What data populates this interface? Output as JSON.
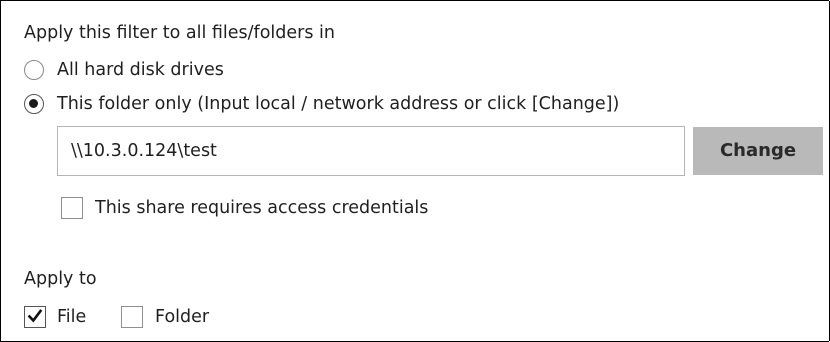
{
  "filter_scope": {
    "heading": "Apply this filter to all files/folders in",
    "options": [
      {
        "label": "All hard disk drives",
        "selected": false
      },
      {
        "label": "This folder only (Input local / network address or click [Change])",
        "selected": true
      }
    ],
    "path_input": {
      "value": "\\\\10.3.0.124\\test"
    },
    "change_button": {
      "label": "Change"
    },
    "credentials_checkbox": {
      "label": "This share requires access credentials",
      "checked": false
    }
  },
  "apply_to": {
    "heading": "Apply to",
    "options": [
      {
        "label": "File",
        "checked": true
      },
      {
        "label": "Folder",
        "checked": false
      }
    ]
  },
  "colors": {
    "button_bg": "#b9b9b9",
    "input_border": "#b5b5b5",
    "text": "#1f1f1f",
    "frame_border": "#000000"
  }
}
